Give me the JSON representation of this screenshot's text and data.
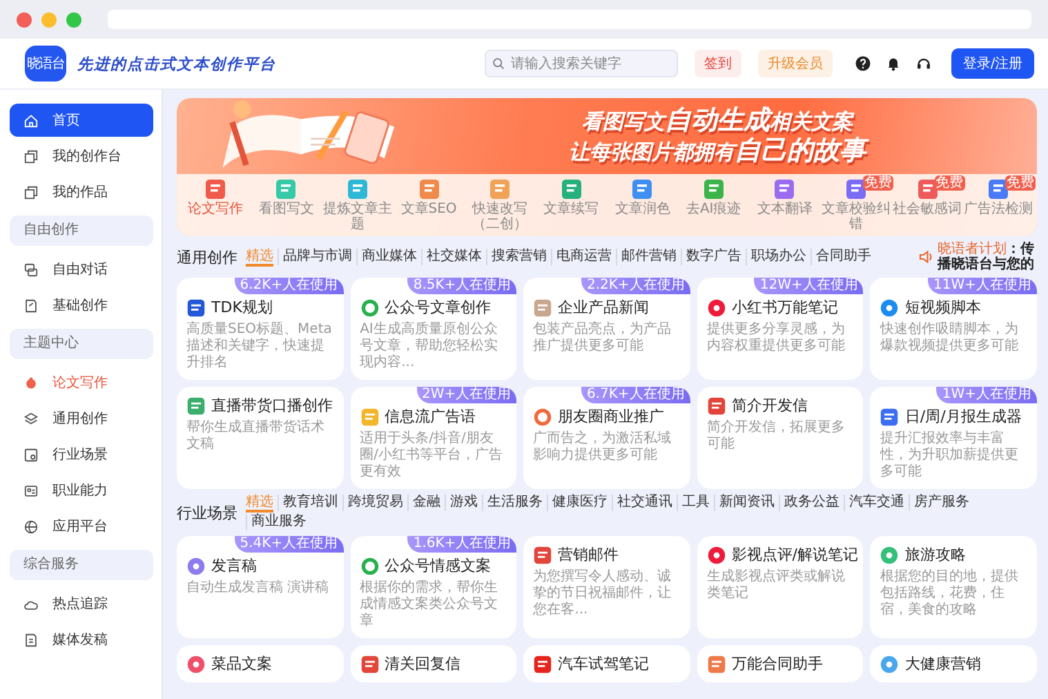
{
  "header": {
    "logo": "晓语台",
    "slogan": "先进的点击式文本创作平台",
    "search": {
      "placeholder": "请输入搜索关键字"
    },
    "checkin": "签到",
    "upgrade": "升级会员",
    "login": "登录/注册"
  },
  "sidebar": {
    "sections": [
      {
        "items": [
          {
            "label": "首页",
            "selected": true,
            "highlighted": false
          },
          {
            "label": "我的创作台",
            "selected": false,
            "highlighted": false
          },
          {
            "label": "我的作品",
            "selected": false,
            "highlighted": false
          }
        ]
      },
      {
        "title": "自由创作",
        "items": [
          {
            "label": "自由对话",
            "selected": false,
            "highlighted": false
          },
          {
            "label": "基础创作",
            "selected": false,
            "highlighted": false
          }
        ]
      },
      {
        "title": "主题中心",
        "items": [
          {
            "label": "论文写作",
            "selected": false,
            "highlighted": true
          },
          {
            "label": "通用创作",
            "selected": false,
            "highlighted": false
          },
          {
            "label": "行业场景",
            "selected": false,
            "highlighted": false
          },
          {
            "label": "职业能力",
            "selected": false,
            "highlighted": false
          },
          {
            "label": "应用平台",
            "selected": false,
            "highlighted": false
          }
        ]
      },
      {
        "title": "综合服务",
        "items": [
          {
            "label": "热点追踪",
            "selected": false,
            "highlighted": false
          },
          {
            "label": "媒体发稿",
            "selected": false,
            "highlighted": false
          }
        ]
      }
    ]
  },
  "banner": {
    "lines": [
      "看图写文**自动生成**相关文案",
      "让每张图片都拥有**自己的故事**"
    ],
    "tools": [
      {
        "label": "论文写作",
        "selected": true
      },
      {
        "label": "看图写文",
        "selected": false
      },
      {
        "label": "提炼文章主题",
        "selected": false
      },
      {
        "label": "文章SEO",
        "selected": false
      },
      {
        "label": "快速改写（二创）",
        "selected": false
      },
      {
        "label": "文章续写",
        "selected": false
      },
      {
        "label": "文章润色",
        "selected": false
      },
      {
        "label": "去AI痕迹",
        "selected": false
      },
      {
        "label": "文本翻译",
        "selected": false
      },
      {
        "label": "文章校验纠错",
        "selected": false,
        "badge": "免费"
      },
      {
        "label": "社会敏感词",
        "selected": false,
        "badge": "免费"
      },
      {
        "label": "广告法检测",
        "selected": false,
        "badge": "免费"
      }
    ]
  },
  "sections": [
    {
      "title": "通用创作",
      "tabs": [
        {
          "label": "精选",
          "selected": true
        },
        {
          "label": "品牌与市调",
          "selected": false
        },
        {
          "label": "商业媒体",
          "selected": false
        },
        {
          "label": "社交媒体",
          "selected": false
        },
        {
          "label": "搜索营销",
          "selected": false
        },
        {
          "label": "电商运营",
          "selected": false
        },
        {
          "label": "邮件营销",
          "selected": false
        },
        {
          "label": "数字广告",
          "selected": false
        },
        {
          "label": "职场办公",
          "selected": false
        },
        {
          "label": "合同助手",
          "selected": false
        }
      ],
      "notice": {
        "label": "晓语者计划",
        "text": "：传播晓语台与您的"
      },
      "cards": [
        {
          "title": "TDK规划",
          "desc": "高质量SEO标题、Meta描述和关键字，快速提升排名",
          "users": "6.2K+人在使用"
        },
        {
          "title": "公众号文章创作",
          "desc": "AI生成高质量原创公众号文章，帮助您轻松实现内容...",
          "users": "8.5K+人在使用"
        },
        {
          "title": "企业产品新闻",
          "desc": "包装产品亮点，为产品推广提供更多可能",
          "users": "2.2K+人在使用"
        },
        {
          "title": "小红书万能笔记",
          "desc": "提供更多分享灵感，为内容权重提供更多可能",
          "users": "12W+人在使用"
        },
        {
          "title": "短视频脚本",
          "desc": "快速创作吸睛脚本，为爆款视频提供更多可能",
          "users": "11W+人在使用"
        },
        {
          "title": "直播带货口播创作",
          "desc": "帮你生成直播带货话术文稿"
        },
        {
          "title": "信息流广告语",
          "desc": "适用于头条/抖音/朋友圈/小红书等平台，广告更有效",
          "users": "2W+人在使用"
        },
        {
          "title": "朋友圈商业推广",
          "desc": "广而告之，为激活私域影响力提供更多可能",
          "users": "6.7K+人在使用"
        },
        {
          "title": "简介开发信",
          "desc": "简介开发信，拓展更多可能"
        },
        {
          "title": "日/周/月报生成器",
          "desc": "提升汇报效率与丰富性，为升职加薪提供更多可能",
          "users": "1W+人在使用"
        }
      ]
    },
    {
      "title": "行业场景",
      "tabs": [
        {
          "label": "精选",
          "selected": true
        },
        {
          "label": "教育培训",
          "selected": false
        },
        {
          "label": "跨境贸易",
          "selected": false
        },
        {
          "label": "金融",
          "selected": false
        },
        {
          "label": "游戏",
          "selected": false
        },
        {
          "label": "生活服务",
          "selected": false
        },
        {
          "label": "健康医疗",
          "selected": false
        },
        {
          "label": "社交通讯",
          "selected": false
        },
        {
          "label": "工具",
          "selected": false
        },
        {
          "label": "新闻资讯",
          "selected": false
        },
        {
          "label": "政务公益",
          "selected": false
        },
        {
          "label": "汽车交通",
          "selected": false
        },
        {
          "label": "房产服务",
          "selected": false
        },
        {
          "label": "商业服务",
          "selected": false
        }
      ],
      "cards": [
        {
          "title": "发言稿",
          "desc": "自动生成发言稿 演讲稿",
          "users": "5.4K+人在使用"
        },
        {
          "title": "公众号情感文案",
          "desc": "根据你的需求，帮你生成情感文案类公众号文章",
          "users": "1.6K+人在使用"
        },
        {
          "title": "营销邮件",
          "desc": "为您撰写令人感动、诚挚的节日祝福邮件，让您在客..."
        },
        {
          "title": "影视点评/解说笔记",
          "desc": "生成影视点评类或解说类笔记"
        },
        {
          "title": "旅游攻略",
          "desc": "根据您的目的地，提供包括路线，花费，住宿，美食的攻略"
        },
        {
          "title": "菜品文案"
        },
        {
          "title": "清关回复信"
        },
        {
          "title": "汽车试驾笔记"
        },
        {
          "title": "万能合同助手"
        },
        {
          "title": "大健康营销"
        }
      ]
    }
  ]
}
